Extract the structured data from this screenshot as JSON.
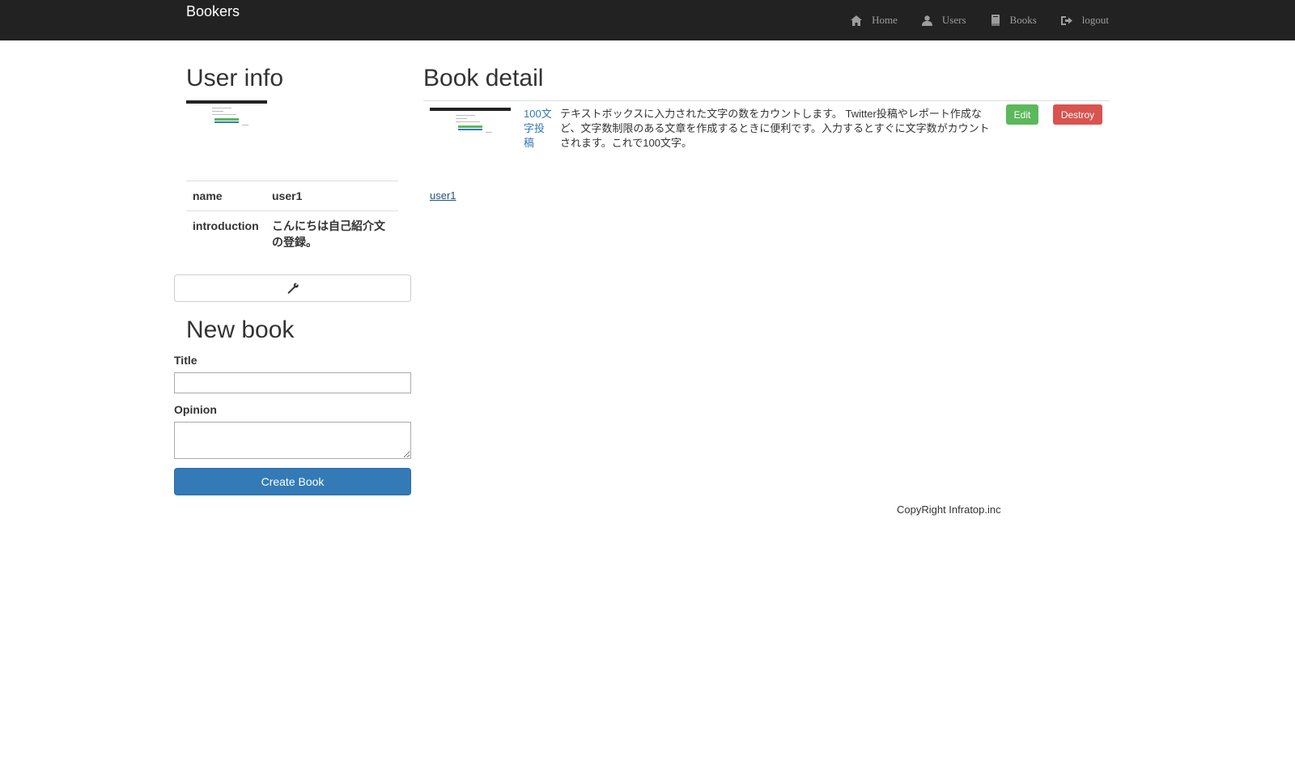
{
  "navbar": {
    "brand": "Bookers",
    "items": [
      {
        "label": "Home",
        "icon": "home-icon"
      },
      {
        "label": "Users",
        "icon": "user-icon"
      },
      {
        "label": "Books",
        "icon": "book-icon"
      },
      {
        "label": "logout",
        "icon": "logout-icon"
      }
    ]
  },
  "user_info": {
    "heading": "User info",
    "rows": [
      {
        "key": "name",
        "value": "user1"
      },
      {
        "key": "introduction",
        "value": "こんにちは自己紹介文の登録。"
      }
    ],
    "edit_icon": "wrench-icon"
  },
  "new_book": {
    "heading": "New book",
    "title_label": "Title",
    "title_value": "",
    "opinion_label": "Opinion",
    "opinion_value": "",
    "submit_label": "Create Book"
  },
  "book_detail": {
    "heading": "Book detail",
    "title": "100文字投稿",
    "body": "テキストボックスに入力された文字の数をカウントします。 Twitter投稿やレポート作成など、文字数制限のある文章を作成するときに便利です。入力するとすぐに文字数がカウントされます。これで100文字。",
    "edit_label": "Edit",
    "destroy_label": "Destroy",
    "user_link": "user1"
  },
  "footer": {
    "text": "CopyRight Infratop.inc"
  },
  "colors": {
    "navbar_bg": "#222222",
    "primary": "#337ab7",
    "success": "#5cb85c",
    "danger": "#d9534f",
    "link": "#23527c"
  }
}
